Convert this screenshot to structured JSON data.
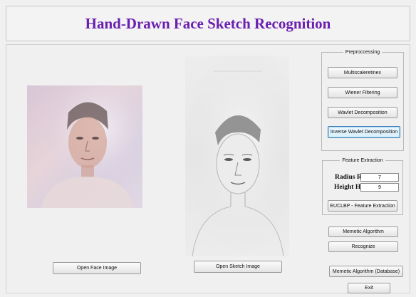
{
  "title": "Hand-Drawn Face Sketch Recognition",
  "preprocessing": {
    "legend": "Preproccessing",
    "buttons": [
      "Multiscaleretinex",
      "Wiener Filtering",
      "Wavlet Decomposition",
      "Inverse Wavlet Decomposition"
    ]
  },
  "feature_extraction": {
    "legend": "Feature Extraction",
    "radius_label": "Radius R :",
    "radius_value": "7",
    "height_label": "Height H :",
    "height_value": "9",
    "button": "EUCLBP - Feature Extraction"
  },
  "actions": {
    "memetic": "Memetic Algorithm",
    "recognize": "Recognize",
    "memetic_db": "Memetic Algorithm (Database)",
    "exit": "Exit",
    "open_face": "Open Face Image",
    "open_sketch": "Open Sketch Image"
  }
}
